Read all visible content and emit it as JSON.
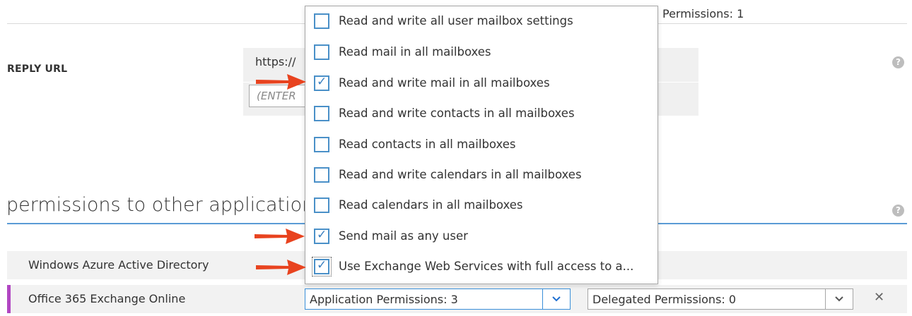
{
  "reply_url": {
    "label": "REPLY URL",
    "value": "https://",
    "placeholder": "(ENTER"
  },
  "permissions": {
    "heading": "permissions to other applications",
    "rows": [
      {
        "name": "Windows Azure Active Directory",
        "delegated_text": "Permissions: 1"
      },
      {
        "name": "Office 365 Exchange Online",
        "app_select": "Application Permissions: 3",
        "delegated_select": "Delegated Permissions: 0"
      }
    ]
  },
  "dropdown": {
    "items": [
      {
        "label": "Read and write all user mailbox settings",
        "checked": false
      },
      {
        "label": "Read mail in all mailboxes",
        "checked": false
      },
      {
        "label": "Read and write mail in all mailboxes",
        "checked": true
      },
      {
        "label": "Read and write contacts in all mailboxes",
        "checked": false
      },
      {
        "label": "Read contacts in all mailboxes",
        "checked": false
      },
      {
        "label": "Read and write calendars in all mailboxes",
        "checked": false
      },
      {
        "label": "Read calendars in all mailboxes",
        "checked": false
      },
      {
        "label": "Send mail as any user",
        "checked": true
      },
      {
        "label": "Use Exchange Web Services with full access to a...",
        "checked": true
      }
    ]
  },
  "icons": {
    "help": "?",
    "check": "✓",
    "chevron": "⌄",
    "close": "✕"
  },
  "colors": {
    "accent_blue": "#5b9bd5",
    "row_accent": "#b146c2",
    "arrow_red": "#e8431f"
  }
}
